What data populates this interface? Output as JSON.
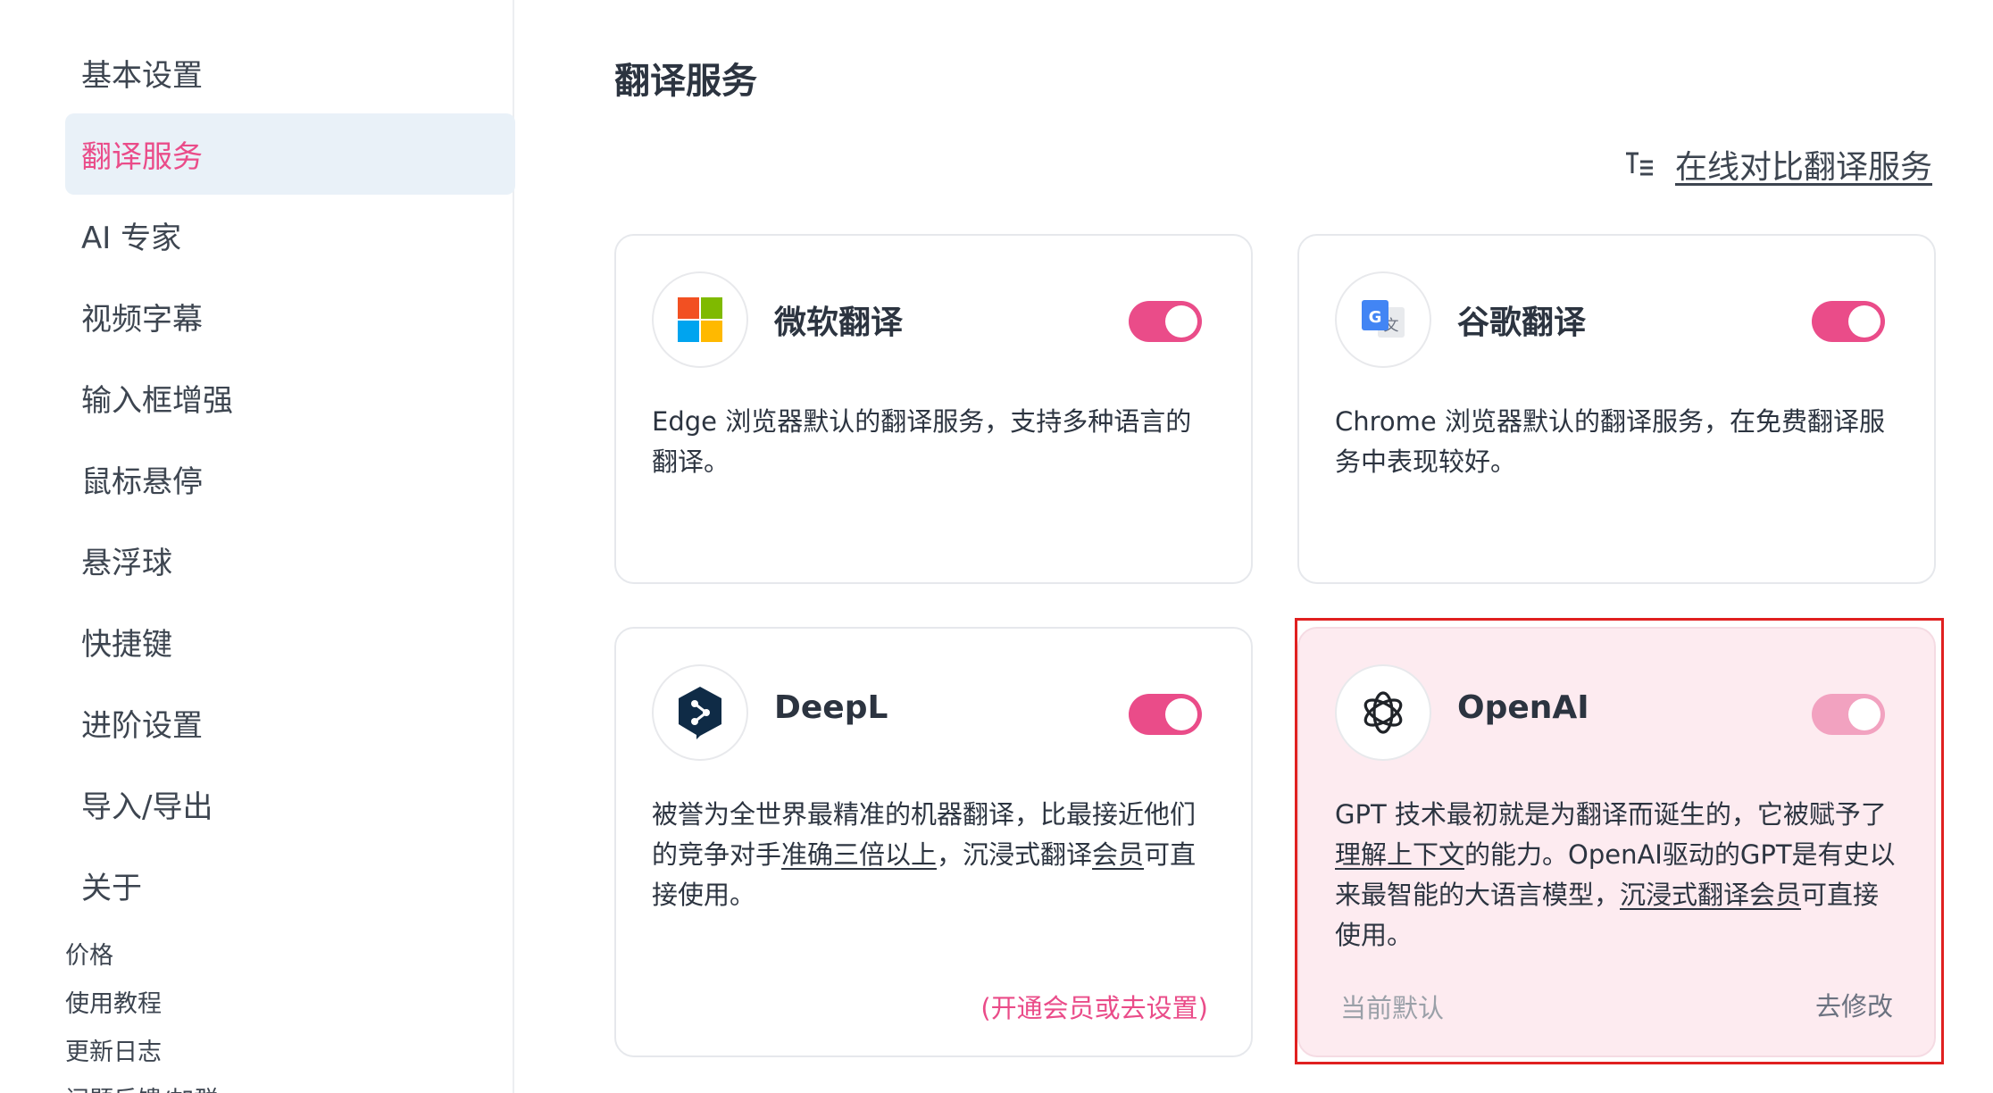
{
  "sidebar": {
    "items": [
      {
        "label": "基本设置"
      },
      {
        "label": "翻译服务"
      },
      {
        "label": "AI 专家"
      },
      {
        "label": "视频字幕"
      },
      {
        "label": "输入框增强"
      },
      {
        "label": "鼠标悬停"
      },
      {
        "label": "悬浮球"
      },
      {
        "label": "快捷键"
      },
      {
        "label": "进阶设置"
      },
      {
        "label": "导入/导出"
      },
      {
        "label": "关于"
      }
    ],
    "active_index": 1,
    "sub_items": [
      {
        "label": "价格"
      },
      {
        "label": "使用教程"
      },
      {
        "label": "更新日志"
      },
      {
        "label": "问题反馈/加群"
      }
    ]
  },
  "main": {
    "title": "翻译服务",
    "compare_link": "在线对比翻译服务",
    "cards": [
      {
        "name": "微软翻译",
        "enabled": true,
        "desc": "Edge 浏览器默认的翻译服务，支持多种语言的翻译。"
      },
      {
        "name": "谷歌翻译",
        "enabled": true,
        "desc": "Chrome 浏览器默认的翻译服务，在免费翻译服务中表现较好。"
      },
      {
        "name": "DeepL",
        "enabled": true,
        "desc_parts": [
          "被誉为全世界最精准的机器翻译，比最接近他们的竞争对手",
          "准确三倍以上",
          "，沉浸式翻译",
          "会员",
          "可直接使用。"
        ],
        "action": "(开通会员或去设置)"
      },
      {
        "name": "OpenAI",
        "enabled": true,
        "desc_parts": [
          "GPT 技术最初就是为翻译而诞生的，它被赋予了",
          "理解上下文",
          "的能力。OpenAI驱动的GPT是有史以来最智能的大语言模型，",
          "沉浸式翻译会员",
          "可直接使用。"
        ],
        "footer_left": "当前默认",
        "footer_right": "去修改"
      }
    ]
  },
  "colors": {
    "accent": "#ea4c89",
    "active_bg": "#e9f1f8",
    "highlight_bg": "#fdebf0",
    "selection_border": "#e02020"
  }
}
